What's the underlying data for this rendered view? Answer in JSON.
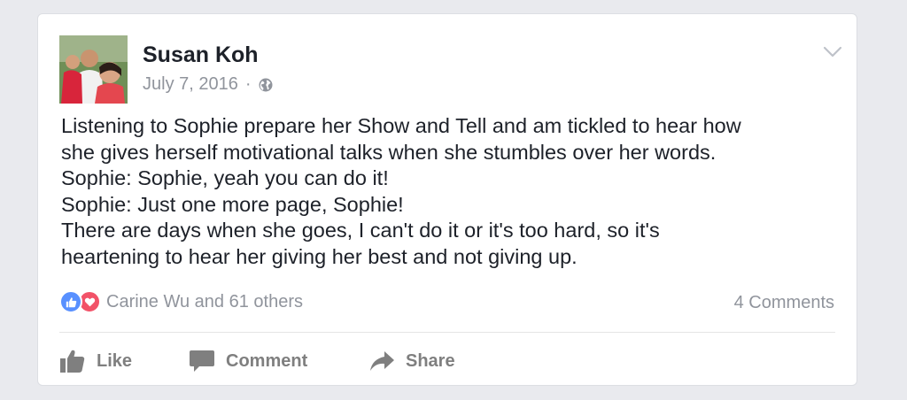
{
  "post": {
    "author": "Susan Koh",
    "date": "July 7, 2016",
    "separator": "·",
    "audience_icon": "globe-icon",
    "menu_icon": "chevron-down-icon",
    "lines": [
      "Listening to Sophie prepare her Show and Tell and am tickled to hear how",
      "she gives herself motivational talks when she stumbles over her words.",
      "Sophie: Sophie, yeah you can do it!",
      "Sophie: Just one more page, Sophie!",
      "There are days when she goes, I can't do it or it's too hard, so it's",
      "heartening to hear her giving her best and not giving up."
    ]
  },
  "reactions": {
    "icons": [
      "like-reaction-icon",
      "love-reaction-icon"
    ],
    "summary": "Carine Wu and 61 others",
    "comments_count": "4 Comments"
  },
  "actions": {
    "like": "Like",
    "comment": "Comment",
    "share": "Share"
  },
  "colors": {
    "background": "#e9eaee",
    "card": "#ffffff",
    "secondary_text": "#90949c",
    "like_blue": "#5890ff",
    "love_red": "#f25268",
    "action_gray": "#7f7f7f"
  }
}
